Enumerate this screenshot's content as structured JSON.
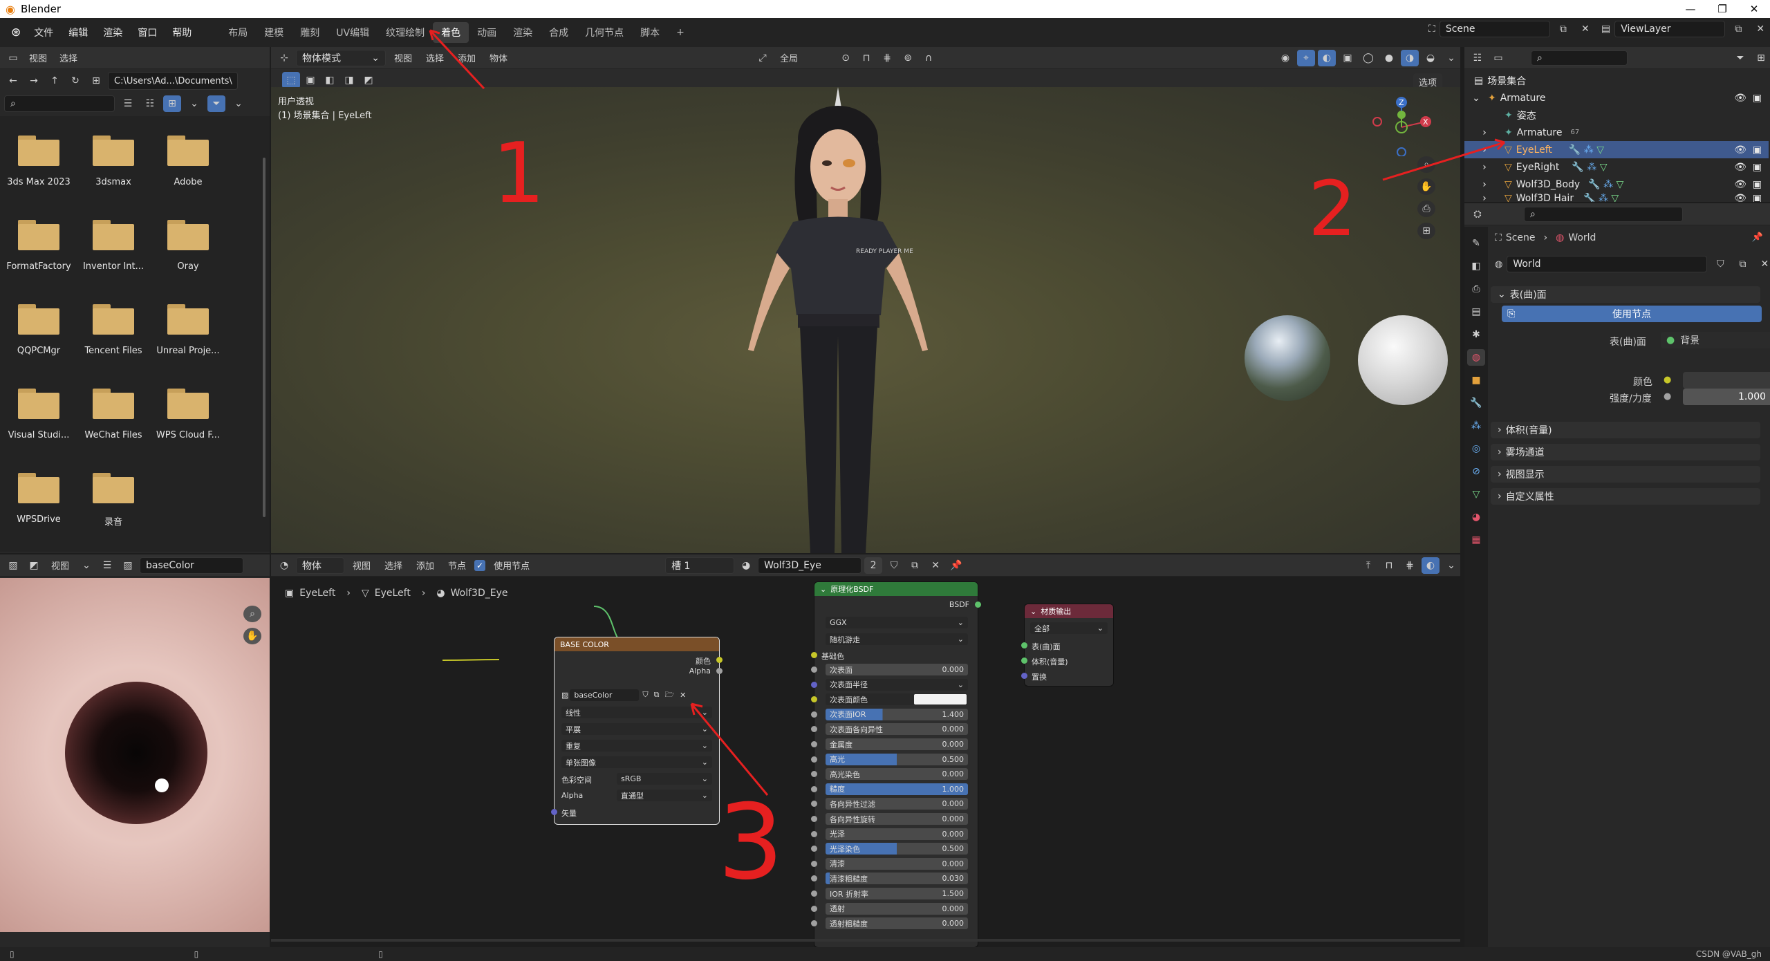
{
  "window": {
    "title": "Blender",
    "controls": [
      "—",
      "❐",
      "✕"
    ]
  },
  "menu": [
    "文件",
    "编辑",
    "渲染",
    "窗口",
    "帮助"
  ],
  "workspaces": [
    "布局",
    "建模",
    "雕刻",
    "UV编辑",
    "纹理绘制",
    "着色",
    "动画",
    "渲染",
    "合成",
    "几何节点",
    "脚本"
  ],
  "active_workspace": "着色",
  "scene": {
    "name": "Scene",
    "view_layer": "ViewLayer"
  },
  "file_browser": {
    "menu": [
      "视图",
      "选择"
    ],
    "path": "C:\\Users\\Ad...\\Documents\\",
    "folders": [
      "3ds Max 2023",
      "3dsmax",
      "Adobe",
      "FormatFactory",
      "Inventor Int...",
      "Oray",
      "QQPCMgr",
      "Tencent Files",
      "Unreal Proje...",
      "Visual Studi...",
      "WeChat Files",
      "WPS Cloud F...",
      "WPSDrive",
      "录音"
    ]
  },
  "viewport": {
    "mode": "物体模式",
    "menu": [
      "视图",
      "选择",
      "添加",
      "物体"
    ],
    "orientation": "全局",
    "options": "选项",
    "overlay_line1": "用户透视",
    "overlay_line2": "(1) 场景集合 | EyeLeft",
    "shirt_text": "READY PLAYER ME"
  },
  "image_editor": {
    "menu": [
      "视图"
    ],
    "image_name": "baseColor"
  },
  "node_editor": {
    "mode": "物体",
    "menu": [
      "视图",
      "选择",
      "添加",
      "节点"
    ],
    "use_nodes_label": "使用节点",
    "slot": "槽 1",
    "material": "Wolf3D_Eye",
    "users": "2",
    "breadcrumb": [
      "EyeLeft",
      "EyeLeft",
      "Wolf3D_Eye"
    ]
  },
  "image_node": {
    "title": "BASE COLOR",
    "out_color": "颜色",
    "out_alpha": "Alpha",
    "image": "baseColor",
    "interpolation": "线性",
    "projection": "平展",
    "extension": "重复",
    "source": "单张图像",
    "colorspace_label": "色彩空间",
    "colorspace": "sRGB",
    "alpha_label": "Alpha",
    "alpha_mode": "直通型",
    "vector": "矢量"
  },
  "bsdf_node": {
    "title": "原理化BSDF",
    "output": "BSDF",
    "distribution": "GGX",
    "subsurface_method": "随机游走",
    "base_color": "基础色",
    "rows": [
      {
        "label": "次表面",
        "value": "0.000",
        "fill": 0,
        "socket": "#a1a1a1"
      },
      {
        "label": "次表面半径",
        "value": "",
        "fill": 0,
        "socket": "#6363c7",
        "dropdown": true
      },
      {
        "label": "次表面颜色",
        "value": "",
        "fill": 0,
        "socket": "#c7c729",
        "color": true
      },
      {
        "label": "次表面IOR",
        "value": "1.400",
        "fill": 40,
        "socket": "#a1a1a1"
      },
      {
        "label": "次表面各向异性",
        "value": "0.000",
        "fill": 0,
        "socket": "#a1a1a1"
      },
      {
        "label": "金属度",
        "value": "0.000",
        "fill": 0,
        "socket": "#a1a1a1"
      },
      {
        "label": "高光",
        "value": "0.500",
        "fill": 50,
        "socket": "#a1a1a1"
      },
      {
        "label": "高光染色",
        "value": "0.000",
        "fill": 0,
        "socket": "#a1a1a1"
      },
      {
        "label": "糙度",
        "value": "1.000",
        "fill": 100,
        "socket": "#a1a1a1"
      },
      {
        "label": "各向异性过滤",
        "value": "0.000",
        "fill": 0,
        "socket": "#a1a1a1"
      },
      {
        "label": "各向异性旋转",
        "value": "0.000",
        "fill": 0,
        "socket": "#a1a1a1"
      },
      {
        "label": "光泽",
        "value": "0.000",
        "fill": 0,
        "socket": "#a1a1a1"
      },
      {
        "label": "光泽染色",
        "value": "0.500",
        "fill": 50,
        "socket": "#a1a1a1"
      },
      {
        "label": "清漆",
        "value": "0.000",
        "fill": 0,
        "socket": "#a1a1a1"
      },
      {
        "label": "清漆粗糙度",
        "value": "0.030",
        "fill": 3,
        "socket": "#a1a1a1"
      },
      {
        "label": "IOR 折射率",
        "value": "1.500",
        "fill": 0,
        "socket": "#a1a1a1"
      },
      {
        "label": "透射",
        "value": "0.000",
        "fill": 0,
        "socket": "#a1a1a1"
      },
      {
        "label": "透射粗糙度",
        "value": "0.000",
        "fill": 0,
        "socket": "#a1a1a1"
      }
    ]
  },
  "output_node": {
    "title": "材质输出",
    "target": "全部",
    "sockets": [
      "表(曲)面",
      "体积(音量)",
      "置换"
    ]
  },
  "outliner": {
    "root": "场景集合",
    "items": [
      {
        "label": "Armature",
        "indent": 0,
        "selected": false
      },
      {
        "label": "姿态",
        "indent": 1,
        "selected": false
      },
      {
        "label": "Armature",
        "indent": 1,
        "selected": false,
        "badge": "67"
      },
      {
        "label": "EyeLeft",
        "indent": 1,
        "selected": true
      },
      {
        "label": "EyeRight",
        "indent": 1,
        "selected": false
      },
      {
        "label": "Wolf3D_Body",
        "indent": 1,
        "selected": false
      },
      {
        "label": "Wolf3D Hair",
        "indent": 1,
        "selected": false
      }
    ]
  },
  "properties": {
    "breadcrumb": [
      "Scene",
      "World"
    ],
    "world_name": "World",
    "surface_panel": "表(曲)面",
    "use_nodes": "使用节点",
    "surface_label": "表(曲)面",
    "surface_value": "背景",
    "color_label": "颜色",
    "strength_label": "强度/力度",
    "strength_value": "1.000",
    "panels": [
      "体积(音量)",
      "雾场通道",
      "视图显示",
      "自定义属性"
    ]
  },
  "annotations": [
    "1",
    "2",
    "3"
  ],
  "watermark": "CSDN @VAB_gh"
}
